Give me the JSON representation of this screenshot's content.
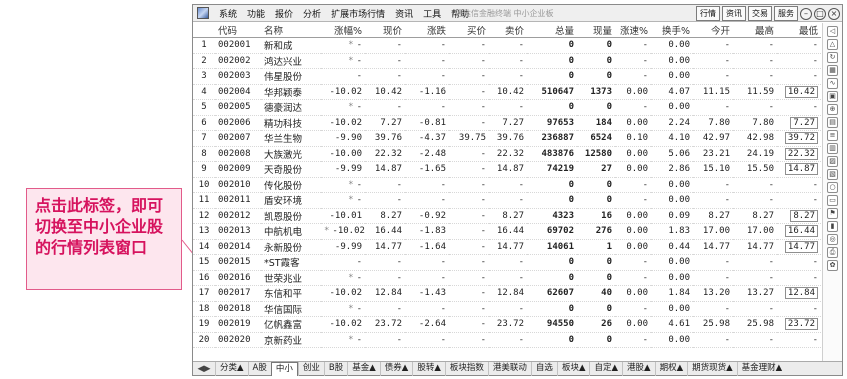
{
  "callout": {
    "text": "点击此标签，即可切换至中小企业股的行情列表窗口"
  },
  "menubar": {
    "items": [
      "系统",
      "功能",
      "报价",
      "分析",
      "扩展市场行情",
      "资讯",
      "工具",
      "帮助"
    ],
    "center_text": "通达信金融终端  中小企业板",
    "right_buttons": [
      "行情",
      "资讯",
      "交易",
      "服务"
    ]
  },
  "table": {
    "headers": [
      "",
      "代码",
      "名称",
      "涨幅%",
      "现价",
      "涨跌",
      "买价",
      "卖价",
      "总量",
      "现量",
      "涨速%",
      "换手%",
      "今开",
      "最高",
      "最低"
    ],
    "rows": [
      {
        "idx": "1",
        "code": "002001",
        "name": "新和成",
        "star": true,
        "chg_pct": "-",
        "price": "-",
        "chg": "-",
        "bid": "-",
        "ask": "-",
        "vol": "0",
        "cur": "0",
        "speed": "-",
        "turnover": "0.00",
        "open": "-",
        "high": "-",
        "low": "-"
      },
      {
        "idx": "2",
        "code": "002002",
        "name": "鸿达兴业",
        "star": true,
        "chg_pct": "-",
        "price": "-",
        "chg": "-",
        "bid": "-",
        "ask": "-",
        "vol": "0",
        "cur": "0",
        "speed": "-",
        "turnover": "0.00",
        "open": "-",
        "high": "-",
        "low": "-"
      },
      {
        "idx": "3",
        "code": "002003",
        "name": "伟星股份",
        "star": false,
        "chg_pct": "-",
        "price": "-",
        "chg": "-",
        "bid": "-",
        "ask": "-",
        "vol": "0",
        "cur": "0",
        "speed": "-",
        "turnover": "0.00",
        "open": "-",
        "high": "-",
        "low": "-"
      },
      {
        "idx": "4",
        "code": "002004",
        "name": "华邦颖泰",
        "star": false,
        "chg_pct": "-10.02",
        "price": "10.42",
        "chg": "-1.16",
        "bid": "-",
        "ask": "10.42",
        "vol": "510647",
        "cur": "1373",
        "speed": "0.00",
        "turnover": "4.07",
        "open": "11.15",
        "high": "11.59",
        "low": "10.42"
      },
      {
        "idx": "5",
        "code": "002005",
        "name": "德豪润达",
        "star": true,
        "chg_pct": "-",
        "price": "-",
        "chg": "-",
        "bid": "-",
        "ask": "-",
        "vol": "0",
        "cur": "0",
        "speed": "-",
        "turnover": "0.00",
        "open": "-",
        "high": "-",
        "low": "-"
      },
      {
        "idx": "6",
        "code": "002006",
        "name": "精功科技",
        "star": false,
        "chg_pct": "-10.02",
        "price": "7.27",
        "chg": "-0.81",
        "bid": "-",
        "ask": "7.27",
        "vol": "97653",
        "cur": "184",
        "speed": "0.00",
        "turnover": "2.24",
        "open": "7.80",
        "high": "7.80",
        "low": "7.27"
      },
      {
        "idx": "7",
        "code": "002007",
        "name": "华兰生物",
        "star": false,
        "chg_pct": "-9.90",
        "price": "39.76",
        "chg": "-4.37",
        "bid": "39.75",
        "ask": "39.76",
        "vol": "236887",
        "cur": "6524",
        "speed": "0.10",
        "turnover": "4.10",
        "open": "42.97",
        "high": "42.98",
        "low": "39.72"
      },
      {
        "idx": "8",
        "code": "002008",
        "name": "大族激光",
        "star": false,
        "chg_pct": "-10.00",
        "price": "22.32",
        "chg": "-2.48",
        "bid": "-",
        "ask": "22.32",
        "vol": "483876",
        "cur": "12580",
        "speed": "0.00",
        "turnover": "5.06",
        "open": "23.21",
        "high": "24.19",
        "low": "22.32"
      },
      {
        "idx": "9",
        "code": "002009",
        "name": "天奇股份",
        "star": false,
        "chg_pct": "-9.99",
        "price": "14.87",
        "chg": "-1.65",
        "bid": "-",
        "ask": "14.87",
        "vol": "74219",
        "cur": "27",
        "speed": "0.00",
        "turnover": "2.86",
        "open": "15.10",
        "high": "15.50",
        "low": "14.87"
      },
      {
        "idx": "10",
        "code": "002010",
        "name": "传化股份",
        "star": true,
        "chg_pct": "-",
        "price": "-",
        "chg": "-",
        "bid": "-",
        "ask": "-",
        "vol": "0",
        "cur": "0",
        "speed": "-",
        "turnover": "0.00",
        "open": "-",
        "high": "-",
        "low": "-"
      },
      {
        "idx": "11",
        "code": "002011",
        "name": "盾安环境",
        "star": true,
        "chg_pct": "-",
        "price": "-",
        "chg": "-",
        "bid": "-",
        "ask": "-",
        "vol": "0",
        "cur": "0",
        "speed": "-",
        "turnover": "0.00",
        "open": "-",
        "high": "-",
        "low": "-"
      },
      {
        "idx": "12",
        "code": "002012",
        "name": "凯恩股份",
        "star": false,
        "chg_pct": "-10.01",
        "price": "8.27",
        "chg": "-0.92",
        "bid": "-",
        "ask": "8.27",
        "vol": "4323",
        "cur": "16",
        "speed": "0.00",
        "turnover": "0.09",
        "open": "8.27",
        "high": "8.27",
        "low": "8.27"
      },
      {
        "idx": "13",
        "code": "002013",
        "name": "中航机电",
        "star": true,
        "chg_pct": "-10.02",
        "price": "16.44",
        "chg": "-1.83",
        "bid": "-",
        "ask": "16.44",
        "vol": "69702",
        "cur": "276",
        "speed": "0.00",
        "turnover": "1.83",
        "open": "17.00",
        "high": "17.00",
        "low": "16.44"
      },
      {
        "idx": "14",
        "code": "002014",
        "name": "永新股份",
        "star": false,
        "chg_pct": "-9.99",
        "price": "14.77",
        "chg": "-1.64",
        "bid": "-",
        "ask": "14.77",
        "vol": "14061",
        "cur": "1",
        "speed": "0.00",
        "turnover": "0.44",
        "open": "14.77",
        "high": "14.77",
        "low": "14.77"
      },
      {
        "idx": "15",
        "code": "002015",
        "name": "*ST霞客",
        "star": false,
        "chg_pct": "-",
        "price": "-",
        "chg": "-",
        "bid": "-",
        "ask": "-",
        "vol": "0",
        "cur": "0",
        "speed": "-",
        "turnover": "0.00",
        "open": "-",
        "high": "-",
        "low": "-"
      },
      {
        "idx": "16",
        "code": "002016",
        "name": "世荣兆业",
        "star": true,
        "chg_pct": "-",
        "price": "-",
        "chg": "-",
        "bid": "-",
        "ask": "-",
        "vol": "0",
        "cur": "0",
        "speed": "-",
        "turnover": "0.00",
        "open": "-",
        "high": "-",
        "low": "-"
      },
      {
        "idx": "17",
        "code": "002017",
        "name": "东信和平",
        "star": false,
        "chg_pct": "-10.02",
        "price": "12.84",
        "chg": "-1.43",
        "bid": "-",
        "ask": "12.84",
        "vol": "62607",
        "cur": "40",
        "speed": "0.00",
        "turnover": "1.84",
        "open": "13.20",
        "high": "13.27",
        "low": "12.84"
      },
      {
        "idx": "18",
        "code": "002018",
        "name": "华信国际",
        "star": true,
        "chg_pct": "-",
        "price": "-",
        "chg": "-",
        "bid": "-",
        "ask": "-",
        "vol": "0",
        "cur": "0",
        "speed": "-",
        "turnover": "0.00",
        "open": "-",
        "high": "-",
        "low": "-"
      },
      {
        "idx": "19",
        "code": "002019",
        "name": "亿帆鑫富",
        "star": false,
        "chg_pct": "-10.02",
        "price": "23.72",
        "chg": "-2.64",
        "bid": "-",
        "ask": "23.72",
        "vol": "94550",
        "cur": "26",
        "speed": "0.00",
        "turnover": "4.61",
        "open": "25.98",
        "high": "25.98",
        "low": "23.72"
      },
      {
        "idx": "20",
        "code": "002020",
        "name": "京新药业",
        "star": true,
        "chg_pct": "-",
        "price": "-",
        "chg": "-",
        "bid": "-",
        "ask": "-",
        "vol": "0",
        "cur": "0",
        "speed": "-",
        "turnover": "0.00",
        "open": "-",
        "high": "-",
        "low": "-"
      }
    ]
  },
  "tabs": {
    "items": [
      "分类▲",
      "A股",
      "中小",
      "创业",
      "B股",
      "基金▲",
      "债券▲",
      "股转▲",
      "板块指数",
      "港美联动",
      "自选",
      "板块▲",
      "自定▲",
      "港股▲",
      "期权▲",
      "期货现货▲",
      "基金理财▲"
    ],
    "active_index": 2
  },
  "side_icons": [
    "arrow-left-icon",
    "arrow-up-icon",
    "refresh-icon",
    "grid-icon",
    "chart-icon",
    "window-icon",
    "zoom-icon",
    "calendar-icon",
    "list-icon",
    "compare-icon",
    "image-icon",
    "fund-icon",
    "circle-icon",
    "folder-icon",
    "flag-icon",
    "bar-icon",
    "target-icon",
    "print-icon",
    "settings-icon"
  ],
  "colors": {
    "callout_text": "#d6135e",
    "callout_border": "#e25b8a",
    "callout_bg": "#fde6ee"
  }
}
